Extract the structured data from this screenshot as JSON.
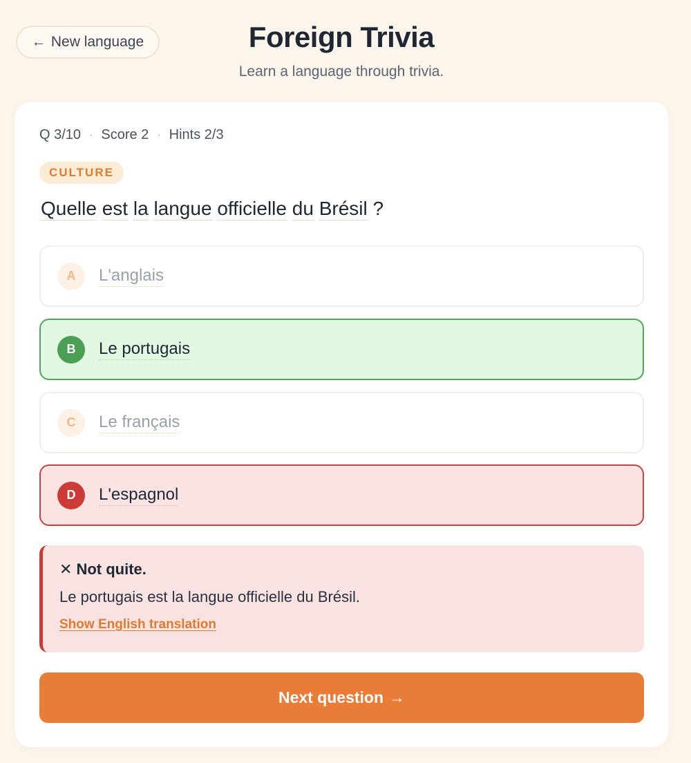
{
  "nav": {
    "back_label": "New language",
    "back_arrow": "←"
  },
  "header": {
    "title": "Foreign Trivia",
    "subtitle": "Learn a language through trivia."
  },
  "meta": {
    "question": "Q 3/10",
    "score": "Score 2",
    "hints": "Hints 2/3",
    "separator": "·"
  },
  "category": "CULTURE",
  "question": {
    "words": [
      "Quelle",
      "est",
      "la",
      "langue",
      "officielle",
      "du",
      "Brésil"
    ],
    "end": "?"
  },
  "options": [
    {
      "letter": "A",
      "text": "L'anglais",
      "state": "dimmed"
    },
    {
      "letter": "B",
      "text": "Le portugais",
      "state": "correct"
    },
    {
      "letter": "C",
      "text": "Le français",
      "state": "dimmed"
    },
    {
      "letter": "D",
      "text": "L'espagnol",
      "state": "wrong"
    }
  ],
  "feedback": {
    "icon": "✕",
    "title": "Not quite.",
    "body": "Le portugais est la langue officielle du Brésil.",
    "link": "Show English translation"
  },
  "next_button": {
    "label": "Next question",
    "arrow": "→"
  },
  "colors": {
    "accent": "#e97d37",
    "correct": "#4caa57",
    "wrong": "#cc3b35",
    "background": "#fcf5ec"
  }
}
